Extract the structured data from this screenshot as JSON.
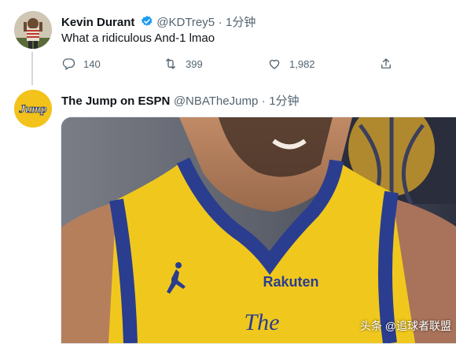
{
  "tweet1": {
    "author_name": "Kevin Durant",
    "handle": "@KDTrey5",
    "separator": "·",
    "time": "1分钟",
    "text": "What a ridiculous And-1 lmao",
    "replies": "140",
    "retweets": "399",
    "likes": "1,982"
  },
  "tweet2": {
    "author_name": "The Jump on ESPN",
    "handle": "@NBATheJump",
    "separator": "·",
    "time": "1分钟",
    "avatar_text": "Jump",
    "jersey_sponsor": "Rakuten",
    "jersey_script": "The"
  },
  "watermark": "头条 @追球者联盟",
  "colors": {
    "verified": "#1d9bf0",
    "jersey_yellow": "#f0c81d",
    "jersey_blue": "#2a3d8f",
    "secondary_text": "#536471"
  },
  "icons": {
    "reply": "reply-icon",
    "retweet": "retweet-icon",
    "like": "like-icon",
    "share": "share-icon",
    "verified": "verified-badge-icon"
  }
}
